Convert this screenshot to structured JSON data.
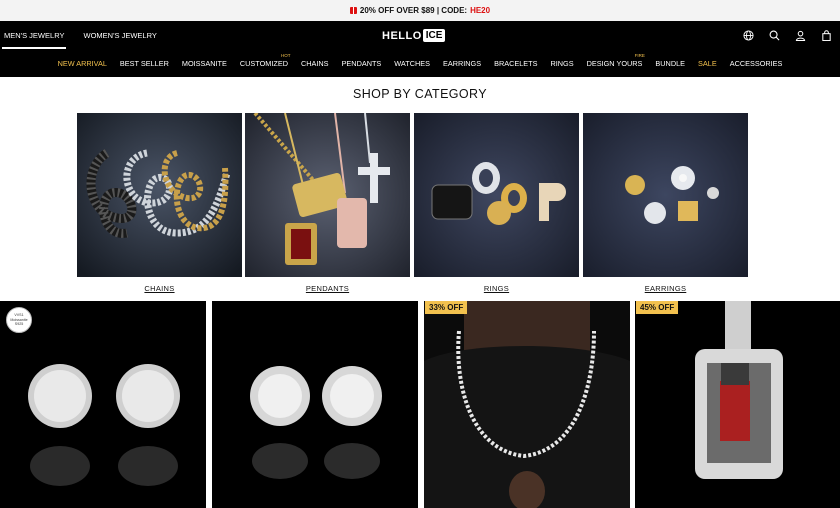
{
  "promo": {
    "text": "20% OFF OVER $89 | CODE:",
    "code": "HE20"
  },
  "header": {
    "tabs": [
      {
        "label": "MEN'S JEWELRY"
      },
      {
        "label": "WOMEN'S JEWELRY"
      }
    ],
    "logo": {
      "left": "HELLO",
      "right": "ICE"
    },
    "icons": [
      "globe-icon",
      "search-icon",
      "user-icon",
      "cart-icon"
    ]
  },
  "nav": [
    {
      "label": "NEW ARRIVAL"
    },
    {
      "label": "BEST SELLER"
    },
    {
      "label": "MOISSANITE"
    },
    {
      "label": "CUSTOMIZED",
      "tag": "HOT"
    },
    {
      "label": "CHAINS"
    },
    {
      "label": "PENDANTS"
    },
    {
      "label": "WATCHES"
    },
    {
      "label": "EARRINGS"
    },
    {
      "label": "BRACELETS"
    },
    {
      "label": "RINGS"
    },
    {
      "label": "DESIGN YOURS",
      "tag": "FIRE"
    },
    {
      "label": "BUNDLE"
    },
    {
      "label": "SALE"
    },
    {
      "label": "ACCESSORIES"
    }
  ],
  "section_title": "SHOP BY CATEGORY",
  "categories": [
    {
      "label": "CHAINS"
    },
    {
      "label": "PENDANTS"
    },
    {
      "label": "RINGS"
    },
    {
      "label": "EARRINGS"
    }
  ],
  "products": [
    {
      "seal": [
        "VVS1",
        "Moissanite",
        "S925"
      ]
    },
    {
      "badge": ""
    },
    {
      "badge": "33% OFF"
    },
    {
      "badge": "45% OFF"
    }
  ],
  "colors": {
    "accent": "#f2c14e",
    "header_bg": "#000000",
    "promo_code": "#dd1111"
  }
}
